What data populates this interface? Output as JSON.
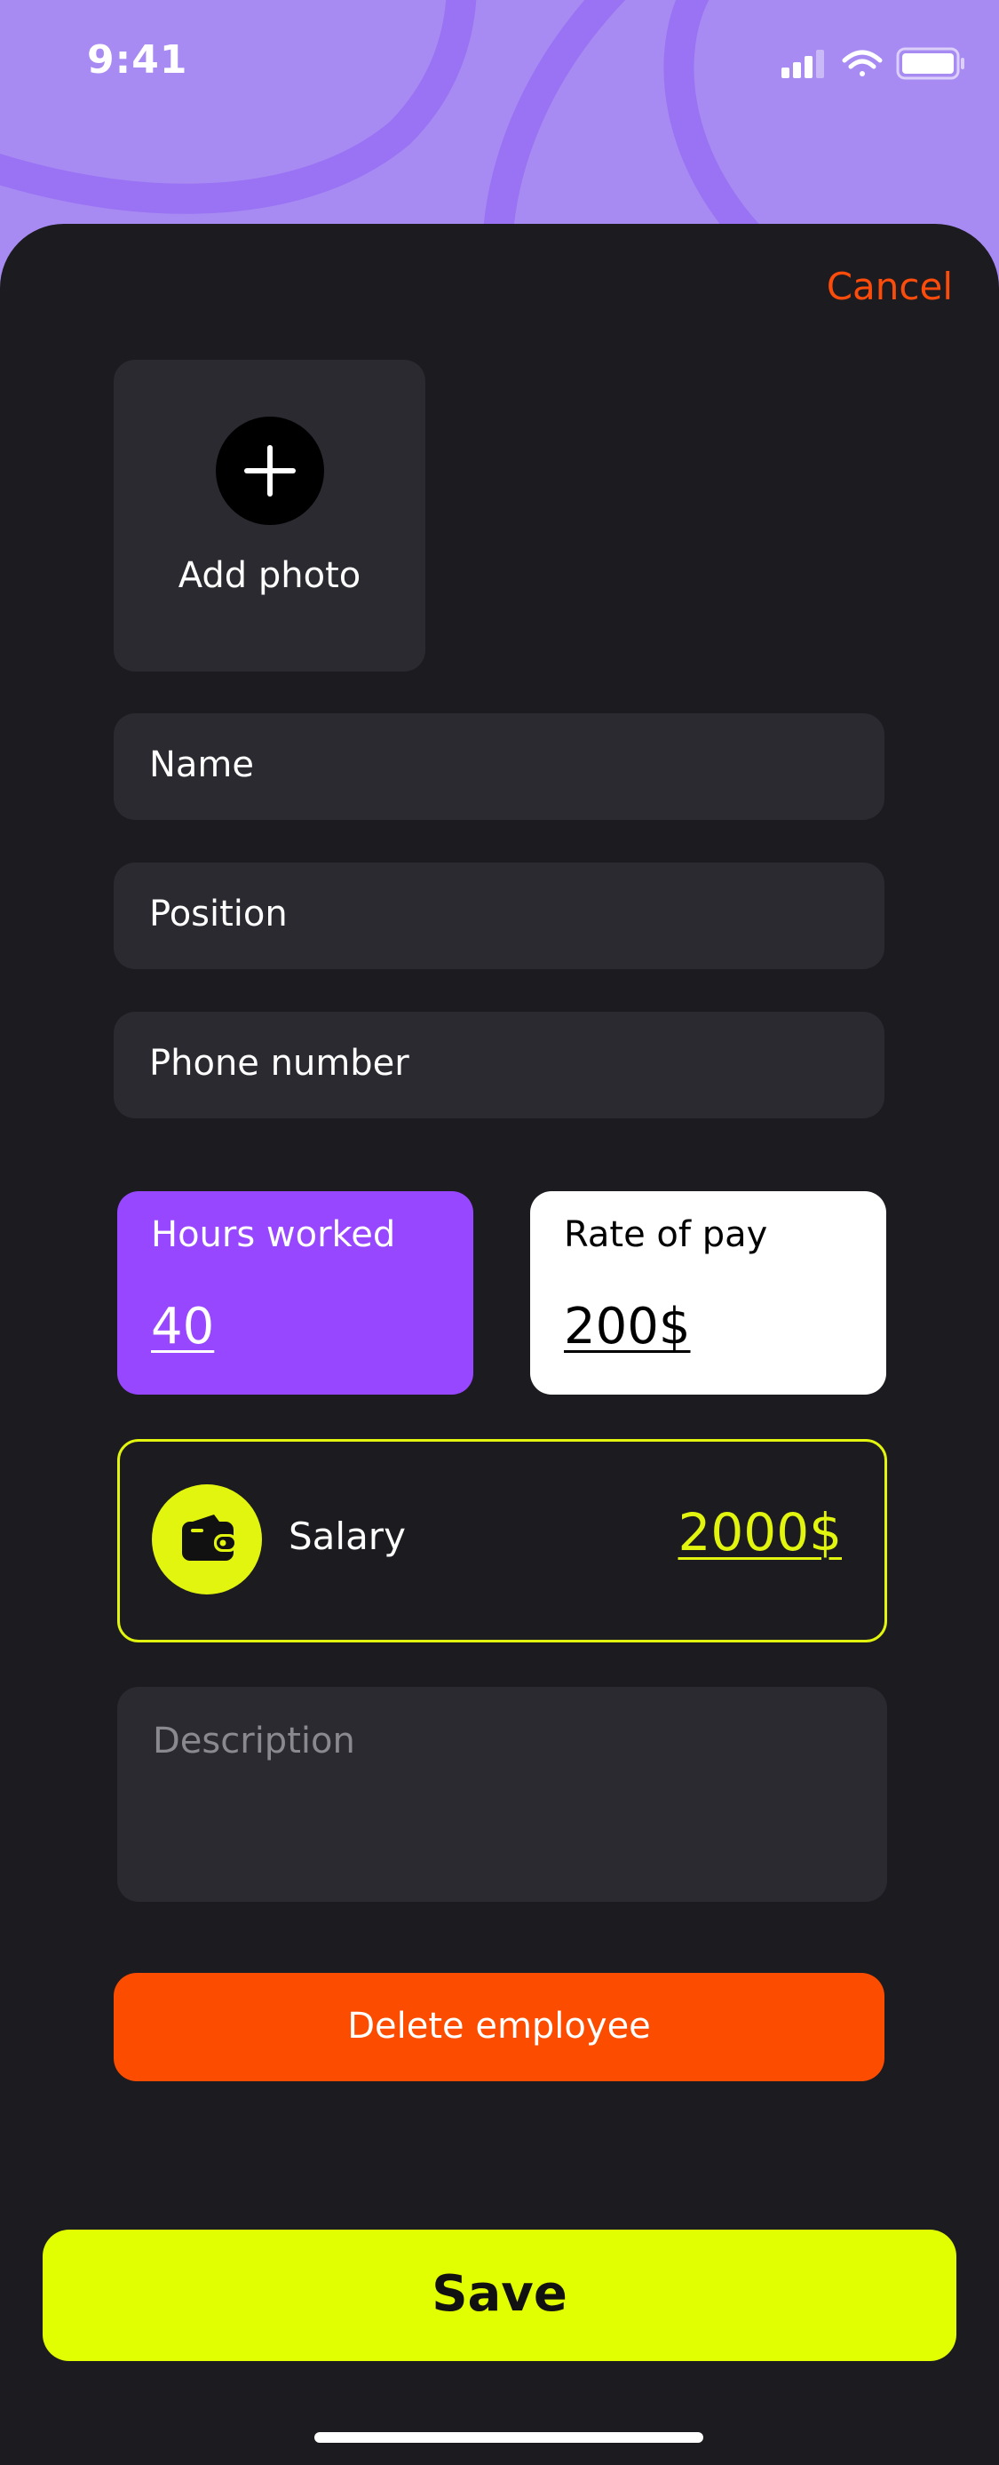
{
  "status_bar": {
    "time": "9:41"
  },
  "header": {
    "cancel_label": "Cancel"
  },
  "photo": {
    "label": "Add photo"
  },
  "form": {
    "name_label": "Name",
    "position_label": "Position",
    "phone_label": "Phone number"
  },
  "stats": {
    "hours_title": "Hours worked",
    "hours_value": "40",
    "rate_title": "Rate of pay",
    "rate_value": "200$"
  },
  "salary": {
    "label": "Salary",
    "value": "2000$"
  },
  "description": {
    "placeholder": "Description"
  },
  "actions": {
    "delete_label": "Delete employee",
    "save_label": "Save"
  },
  "icons": {
    "add_photo": "plus-icon",
    "salary": "wallet-icon",
    "signal": "cellular-signal-icon",
    "wifi": "wifi-icon",
    "battery": "battery-icon"
  },
  "colors": {
    "header_background": "#a78bf2",
    "sheet_background": "#1c1b20",
    "field_background": "#2b2a30",
    "accent_purple": "#9747ff",
    "accent_lime": "#e1ff00",
    "danger_orange": "#fc4c00"
  }
}
